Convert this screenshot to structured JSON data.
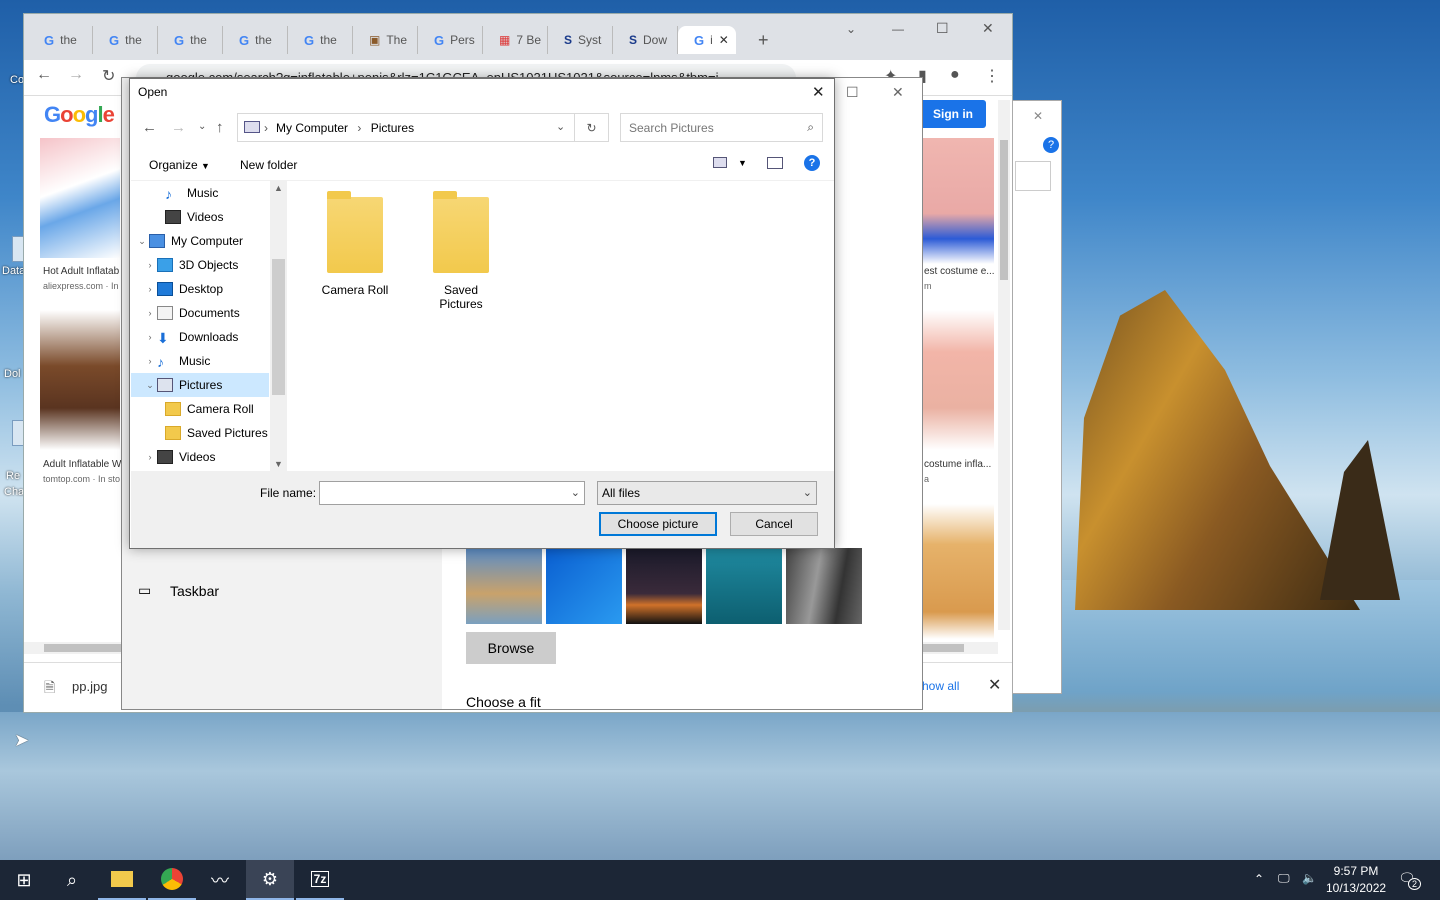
{
  "desktop": {
    "icons": [
      "Co",
      "Data",
      "Dol",
      "Re",
      "Cha"
    ]
  },
  "chrome": {
    "tabs": [
      "the",
      "the",
      "the",
      "the",
      "the",
      "The",
      "Pers",
      "7 Be",
      "Syst",
      "Dow",
      "i"
    ],
    "active_tab": "i",
    "url": "google.com/search?q=inflatable+penis&rlz=1C1GCEA_enUS1021US1021&source=lnms&tbm=i",
    "sign_in": "Sign in",
    "results": [
      {
        "caption": "Hot Adult Inflatab",
        "source": "aliexpress.com · In"
      },
      {
        "caption": "Adult Inflatable W",
        "source": "tomtop.com · In sto"
      },
      {
        "caption": "est costume e...",
        "source": "m"
      },
      {
        "caption": "costume infla...",
        "source": "a"
      }
    ],
    "download_file": "pp.jpg",
    "show_all": "how all"
  },
  "settings": {
    "taskbar_label": "Taskbar",
    "browse": "Browse",
    "choose_fit": "Choose a fit"
  },
  "dialog": {
    "title": "Open",
    "breadcrumb": [
      "My Computer",
      "Pictures"
    ],
    "search_placeholder": "Search Pictures",
    "organize": "Organize",
    "new_folder": "New folder",
    "nav": [
      {
        "label": "Music",
        "indent": 2,
        "exp": "",
        "icon": "music",
        "sel": false
      },
      {
        "label": "Videos",
        "indent": 2,
        "exp": "",
        "icon": "video",
        "sel": false
      },
      {
        "label": "My Computer",
        "indent": 0,
        "exp": "v",
        "icon": "computer",
        "sel": false
      },
      {
        "label": "3D Objects",
        "indent": 1,
        "exp": ">",
        "icon": "cube",
        "sel": false
      },
      {
        "label": "Desktop",
        "indent": 1,
        "exp": ">",
        "icon": "desktop",
        "sel": false
      },
      {
        "label": "Documents",
        "indent": 1,
        "exp": ">",
        "icon": "doc",
        "sel": false
      },
      {
        "label": "Downloads",
        "indent": 1,
        "exp": ">",
        "icon": "download",
        "sel": false
      },
      {
        "label": "Music",
        "indent": 1,
        "exp": ">",
        "icon": "music",
        "sel": false
      },
      {
        "label": "Pictures",
        "indent": 1,
        "exp": "v",
        "icon": "pictures",
        "sel": true
      },
      {
        "label": "Camera Roll",
        "indent": 2,
        "exp": "",
        "icon": "folder",
        "sel": false
      },
      {
        "label": "Saved Pictures",
        "indent": 2,
        "exp": "",
        "icon": "folder",
        "sel": false
      },
      {
        "label": "Videos",
        "indent": 1,
        "exp": ">",
        "icon": "video",
        "sel": false
      }
    ],
    "folders": [
      "Camera Roll",
      "Saved Pictures"
    ],
    "file_name_label": "File name:",
    "file_name_value": "",
    "file_type": "All files",
    "choose_button": "Choose picture",
    "cancel_button": "Cancel"
  },
  "taskbar": {
    "time": "9:57 PM",
    "date": "10/13/2022",
    "notifications": "2"
  }
}
